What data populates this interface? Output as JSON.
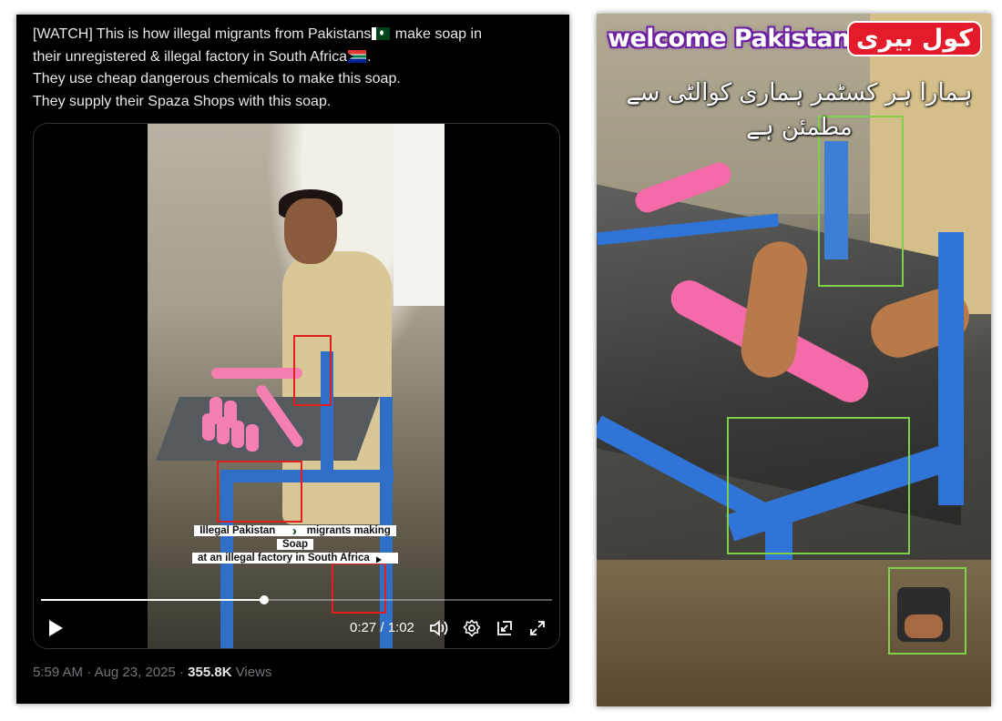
{
  "tweet": {
    "text_lines": [
      "[WATCH] This is how illegal migrants from Pakistans",
      " make soap in",
      "their unregistered & illegal factory in South Africa",
      ".",
      "They use cheap dangerous chemicals to make this soap.",
      "They supply their Spaza Shops with this soap."
    ],
    "video": {
      "caption_line1": "Illegal Pakistan",
      "caption_line1b": "migrants making Soap",
      "caption_line2": "at an illegal factory in South Africa",
      "time": "0:27 / 1:02",
      "progress": 0.436
    },
    "meta": {
      "time": "5:59 AM",
      "date": "Aug 23, 2025",
      "separator": " · ",
      "views_count": "355.8K",
      "views_label": " Views"
    }
  },
  "still": {
    "welcome_text": "welcome Pakistan",
    "brand_text": "کول بیری",
    "urdu_caption": "ہمارا ہر کسٹمر ہماری کوالٹی سے مطمئن ہے"
  },
  "colors": {
    "highlight_red": "#e0201c",
    "highlight_green": "#7fd04a",
    "tweet_bg": "#000000",
    "text_primary": "#e7e9ea",
    "text_secondary": "#71767b"
  },
  "icons": [
    "play-icon",
    "volume-icon",
    "settings-icon",
    "pip-icon",
    "fullscreen-icon",
    "pakistan-flag-icon",
    "south-africa-flag-icon"
  ]
}
